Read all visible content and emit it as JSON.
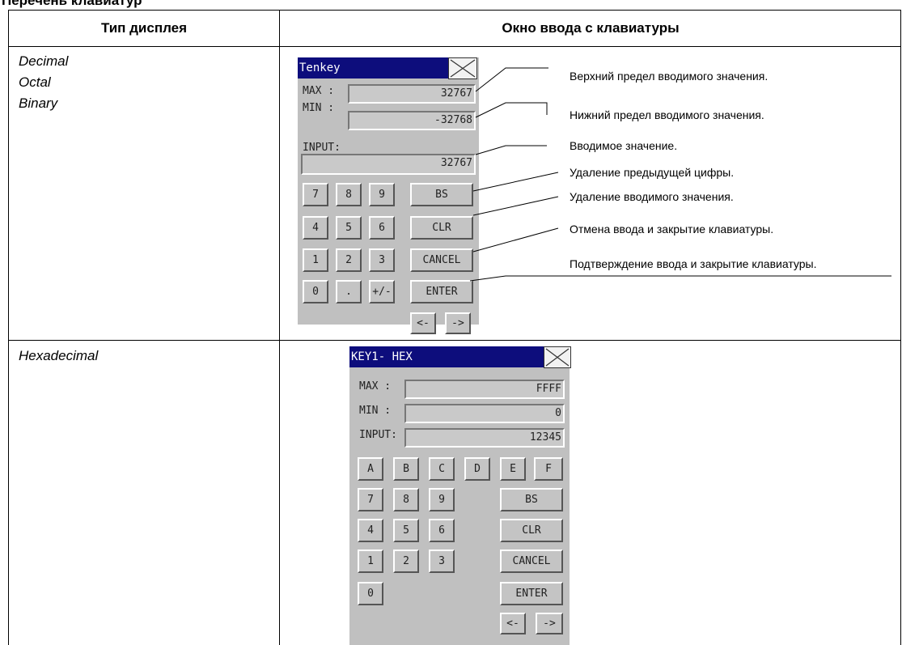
{
  "heading": "Перечень клавиатур",
  "columns": {
    "left": "Тип дисплея",
    "right": "Окно ввода с клавиатуры"
  },
  "row1": {
    "types": [
      "Decimal",
      "Octal",
      "Binary"
    ],
    "keypad": {
      "title": "Tenkey",
      "max_label": "MAX :",
      "max_value": "32767",
      "min_label": "MIN :",
      "min_value": "-32768",
      "input_label": "INPUT:",
      "input_value": "32767",
      "keys": [
        "7",
        "8",
        "9",
        "4",
        "5",
        "6",
        "1",
        "2",
        "3",
        "0",
        ".",
        "+/-"
      ],
      "bs": "BS",
      "clr": "CLR",
      "cancel": "CANCEL",
      "enter": "ENTER",
      "left": "<-",
      "right": "->"
    },
    "callouts": [
      "Верхний предел вводимого значения.",
      "Нижний предел вводимого значения.",
      "Вводимое значение.",
      "Удаление предыдущей цифры.",
      "Удаление вводимого значения.",
      "Отмена ввода и закрытие клавиатуры.",
      "Подтверждение ввода и закрытие клавиатуры."
    ]
  },
  "row2": {
    "types": [
      "Hexadecimal"
    ],
    "keypad": {
      "title": "KEY1- HEX",
      "max_label": "MAX  :",
      "max_value": "FFFF",
      "min_label": "MIN  :",
      "min_value": "0",
      "input_label": "INPUT:",
      "input_value": "12345",
      "hex_keys": [
        "A",
        "B",
        "C",
        "D",
        "E",
        "F"
      ],
      "keys": [
        "7",
        "8",
        "9",
        "4",
        "5",
        "6",
        "1",
        "2",
        "3",
        "0"
      ],
      "bs": "BS",
      "clr": "CLR",
      "cancel": "CANCEL",
      "enter": "ENTER",
      "left": "<-",
      "right": "->"
    }
  }
}
